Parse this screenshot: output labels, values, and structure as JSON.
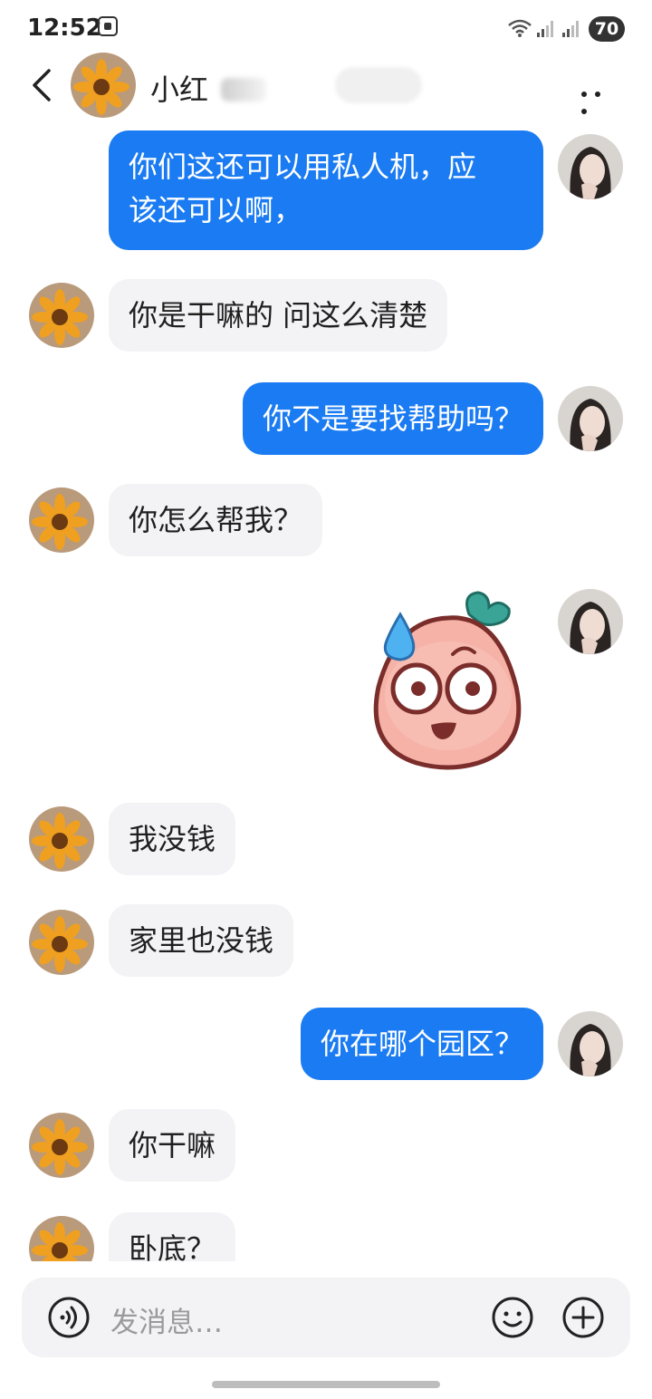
{
  "status_bar": {
    "time": "12:52",
    "battery": "70"
  },
  "header": {
    "contact_name": "小红"
  },
  "messages": [
    {
      "from": "me",
      "text": "你们这还可以用私人机，应该还可以啊，",
      "line1": "你们这还可以用私人机，应",
      "line2": "该还可以啊，"
    },
    {
      "from": "them",
      "text": "你是干嘛的 问这么清楚"
    },
    {
      "from": "me",
      "text": "你不是要找帮助吗？"
    },
    {
      "from": "them",
      "text": "你怎么帮我？"
    },
    {
      "from": "me",
      "sticker": "sweating-blob-sticker"
    },
    {
      "from": "them",
      "text": "我没钱"
    },
    {
      "from": "them",
      "text": "家里也没钱"
    },
    {
      "from": "me",
      "text": "你在哪个园区？"
    },
    {
      "from": "them",
      "text": "你干嘛"
    },
    {
      "from": "them",
      "text": "卧底？"
    }
  ],
  "input": {
    "placeholder": "发消息…"
  },
  "colors": {
    "outgoing_bubble": "#1a7bf2",
    "incoming_bubble": "#f3f3f5"
  }
}
